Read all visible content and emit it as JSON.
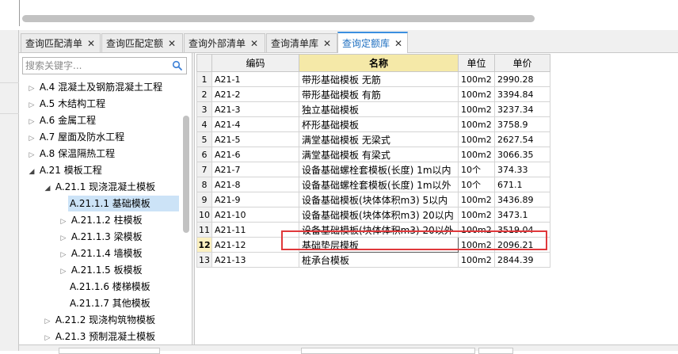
{
  "tabs": [
    {
      "label": "查询匹配清单",
      "active": false
    },
    {
      "label": "查询匹配定额",
      "active": false
    },
    {
      "label": "查询外部清单",
      "active": false
    },
    {
      "label": "查询清单库",
      "active": false
    },
    {
      "label": "查询定额库",
      "active": true
    }
  ],
  "tab_close_glyph": "✕",
  "search": {
    "placeholder": "搜索关键字...",
    "value": "",
    "icon": "search-icon"
  },
  "tree": {
    "items": [
      {
        "label": "A.4 混凝土及钢筋混凝土工程",
        "level": 1,
        "state": "collapsed"
      },
      {
        "label": "A.5 木结构工程",
        "level": 1,
        "state": "collapsed"
      },
      {
        "label": "A.6 金属工程",
        "level": 1,
        "state": "collapsed"
      },
      {
        "label": "A.7 屋面及防水工程",
        "level": 1,
        "state": "collapsed"
      },
      {
        "label": "A.8 保温隔热工程",
        "level": 1,
        "state": "collapsed"
      },
      {
        "label": "A.21 模板工程",
        "level": 1,
        "state": "expanded"
      },
      {
        "label": "A.21.1 现浇混凝土模板",
        "level": 2,
        "state": "expanded"
      },
      {
        "label": "A.21.1.1 基础模板",
        "level": 3,
        "state": "leaf",
        "selected": true
      },
      {
        "label": "A.21.1.2 柱模板",
        "level": 3,
        "state": "collapsed"
      },
      {
        "label": "A.21.1.3 梁模板",
        "level": 3,
        "state": "collapsed"
      },
      {
        "label": "A.21.1.4 墙模板",
        "level": 3,
        "state": "collapsed"
      },
      {
        "label": "A.21.1.5 板模板",
        "level": 3,
        "state": "collapsed"
      },
      {
        "label": "A.21.1.6 楼梯模板",
        "level": 3,
        "state": "leaf"
      },
      {
        "label": "A.21.1.7 其他模板",
        "level": 3,
        "state": "leaf"
      },
      {
        "label": "A.21.2 现浇构筑物模板",
        "level": 2,
        "state": "collapsed"
      },
      {
        "label": "A.21.3 预制混凝土模板",
        "level": 2,
        "state": "collapsed"
      }
    ]
  },
  "grid": {
    "columns": [
      "编码",
      "名称",
      "单位",
      "单价"
    ],
    "current_row": 12,
    "rows": [
      {
        "no": "1",
        "code": "A21-1",
        "name": "带形基础模板 无筋",
        "unit": "100m2",
        "price": "2990.28"
      },
      {
        "no": "2",
        "code": "A21-2",
        "name": "带形基础模板 有筋",
        "unit": "100m2",
        "price": "3394.84"
      },
      {
        "no": "3",
        "code": "A21-3",
        "name": "独立基础模板",
        "unit": "100m2",
        "price": "3237.34"
      },
      {
        "no": "4",
        "code": "A21-4",
        "name": "杯形基础模板",
        "unit": "100m2",
        "price": "3758.9"
      },
      {
        "no": "5",
        "code": "A21-5",
        "name": "满堂基础模板 无梁式",
        "unit": "100m2",
        "price": "2627.54"
      },
      {
        "no": "6",
        "code": "A21-6",
        "name": "满堂基础模板 有梁式",
        "unit": "100m2",
        "price": "3066.35"
      },
      {
        "no": "7",
        "code": "A21-7",
        "name": "设备基础螺栓套模板(长度) 1m以内",
        "unit": "10个",
        "price": "374.33"
      },
      {
        "no": "8",
        "code": "A21-8",
        "name": "设备基础螺栓套模板(长度) 1m以外",
        "unit": "10个",
        "price": "671.1"
      },
      {
        "no": "9",
        "code": "A21-9",
        "name": "设备基础模板(块体体积m3) 5以内",
        "unit": "100m2",
        "price": "3436.89"
      },
      {
        "no": "10",
        "code": "A21-10",
        "name": "设备基础模板(块体体积m3) 20以内",
        "unit": "100m2",
        "price": "3473.1"
      },
      {
        "no": "11",
        "code": "A21-11",
        "name": "设备基础模板(块体体积m3) 20以外",
        "unit": "100m2",
        "price": "3519.04"
      },
      {
        "no": "12",
        "code": "A21-12",
        "name": "基础垫层模板",
        "unit": "100m2",
        "price": "2096.21"
      },
      {
        "no": "13",
        "code": "A21-13",
        "name": "桩承台模板",
        "unit": "100m2",
        "price": "2844.39"
      }
    ]
  },
  "colors": {
    "highlight_box": "#e0383b",
    "active_tab_text": "#1e6fc1",
    "header_highlight": "#f5e9a8",
    "tree_selected": "#cce3f7"
  }
}
